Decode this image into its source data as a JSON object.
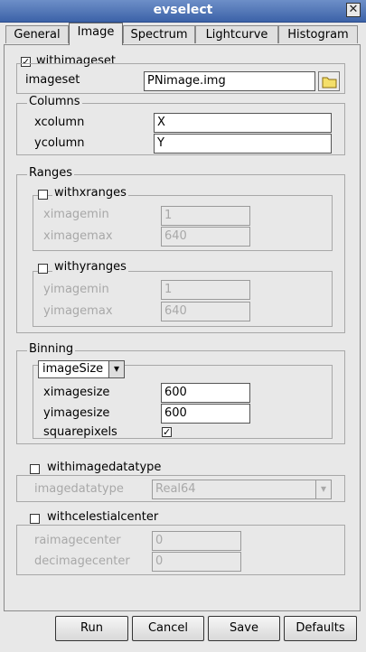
{
  "window": {
    "title": "evselect",
    "close_glyph": "✕"
  },
  "tabs": [
    {
      "label": "General"
    },
    {
      "label": "Image"
    },
    {
      "label": "Spectrum"
    },
    {
      "label": "Lightcurve"
    },
    {
      "label": "Histogram"
    }
  ],
  "image_tab": {
    "withimageset": {
      "label": "withimageset",
      "checked": true
    },
    "imageset": {
      "label": "imageset",
      "value": "PNimage.img",
      "browse_icon": "folder-icon"
    },
    "columns": {
      "legend": "Columns",
      "xcolumn": {
        "label": "xcolumn",
        "value": "X"
      },
      "ycolumn": {
        "label": "ycolumn",
        "value": "Y"
      }
    },
    "ranges": {
      "legend": "Ranges",
      "withxranges": {
        "label": "withxranges",
        "checked": false
      },
      "ximagemin": {
        "label": "ximagemin",
        "value": "1"
      },
      "ximagemax": {
        "label": "ximagemax",
        "value": "640"
      },
      "withyranges": {
        "label": "withyranges",
        "checked": false
      },
      "yimagemin": {
        "label": "yimagemin",
        "value": "1"
      },
      "yimagemax": {
        "label": "yimagemax",
        "value": "640"
      }
    },
    "binning": {
      "legend": "Binning",
      "mode": "imageSize",
      "ximagesize": {
        "label": "ximagesize",
        "value": "600"
      },
      "yimagesize": {
        "label": "yimagesize",
        "value": "600"
      },
      "squarepixels": {
        "label": "squarepixels",
        "checked": true
      }
    },
    "withimagedatatype": {
      "label": "withimagedatatype",
      "checked": false
    },
    "imagedatatype": {
      "label": "imagedatatype",
      "value": "Real64"
    },
    "withcelestialcenter": {
      "label": "withcelestialcenter",
      "checked": false
    },
    "raimagecenter": {
      "label": "raimagecenter",
      "value": "0"
    },
    "decimagecenter": {
      "label": "decimagecenter",
      "value": "0"
    }
  },
  "buttons": {
    "run": "Run",
    "cancel": "Cancel",
    "save": "Save",
    "defaults": "Defaults"
  },
  "glyphs": {
    "check": "✓",
    "dropdown": "▾"
  }
}
